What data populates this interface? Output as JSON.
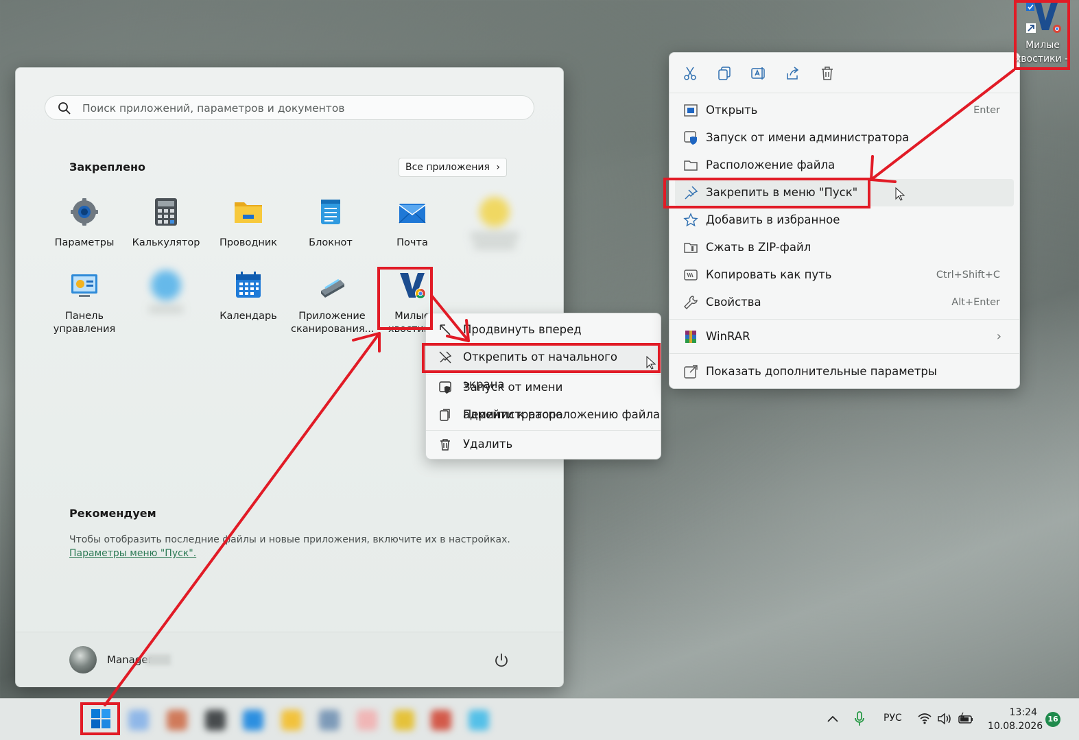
{
  "start_menu": {
    "search_placeholder": "Поиск приложений, параметров и документов",
    "pinned_title": "Закреплено",
    "all_apps_label": "Все приложения",
    "apps": [
      {
        "label": "Параметры",
        "icon": "gear-icon"
      },
      {
        "label": "Калькулятор",
        "icon": "calculator-icon"
      },
      {
        "label": "Проводник",
        "icon": "folder-icon"
      },
      {
        "label": "Блокнот",
        "icon": "notepad-icon"
      },
      {
        "label": "Почта",
        "icon": "mail-icon"
      },
      {
        "label": "",
        "icon": "blurred-app-icon"
      },
      {
        "label": "Панель\nуправления",
        "icon": "control-panel-icon"
      },
      {
        "label": "",
        "icon": "blurred-app-icon"
      },
      {
        "label": "Календарь",
        "icon": "calendar-icon"
      },
      {
        "label": "Приложение\nсканирования...",
        "icon": "scanner-icon"
      },
      {
        "label": "Милые\nхвостики",
        "icon": "viber-chrome-icon"
      }
    ],
    "recommend_title": "Рекомендуем",
    "recommend_text": "Чтобы отобразить последние файлы и новые приложения, включите их в настройках.",
    "recommend_link": "Параметры меню \"Пуск\".",
    "user_name": "Manager"
  },
  "start_context_menu": {
    "items": [
      {
        "label": "Продвинуть вперед",
        "icon": "move-up-left-icon"
      },
      {
        "label": "Открепить от начального экрана",
        "icon": "unpin-icon"
      },
      {
        "label": "Запуск от имени администратора",
        "icon": "admin-shield-icon"
      },
      {
        "label": "Перейти к расположению файла",
        "icon": "file-location-icon"
      },
      {
        "label": "Удалить",
        "icon": "trash-icon"
      }
    ]
  },
  "explorer_context_menu": {
    "toolbar": [
      "cut-icon",
      "copy-icon",
      "rename-icon",
      "share-icon",
      "delete-icon"
    ],
    "items": [
      {
        "label": "Открыть",
        "shortcut": "Enter",
        "icon": "open-icon"
      },
      {
        "label": "Запуск от имени администратора",
        "shortcut": "",
        "icon": "admin-shield-icon"
      },
      {
        "label": "Расположение файла",
        "shortcut": "",
        "icon": "folder-outline-icon"
      },
      {
        "label": "Закрепить в меню \"Пуск\"",
        "shortcut": "",
        "icon": "pin-icon"
      },
      {
        "label": "Добавить в избранное",
        "shortcut": "",
        "icon": "star-icon"
      },
      {
        "label": "Сжать в ZIP-файл",
        "shortcut": "",
        "icon": "zip-icon"
      },
      {
        "label": "Копировать как путь",
        "shortcut": "Ctrl+Shift+C",
        "icon": "copy-path-icon"
      },
      {
        "label": "Свойства",
        "shortcut": "Alt+Enter",
        "icon": "wrench-icon"
      },
      {
        "label": "WinRAR",
        "shortcut": "",
        "icon": "winrar-icon"
      },
      {
        "label": "Показать дополнительные параметры",
        "shortcut": "",
        "icon": "more-options-icon"
      }
    ]
  },
  "desktop_icon": {
    "line1": "Милые",
    "line2": "хвостики - ..."
  },
  "taskbar": {
    "lang": "РУС",
    "time": "13:24",
    "date": "10.08.2026",
    "notifications": "16"
  },
  "colors": {
    "annotation_red": "#e11b26",
    "accent_blue": "#0067c0"
  }
}
